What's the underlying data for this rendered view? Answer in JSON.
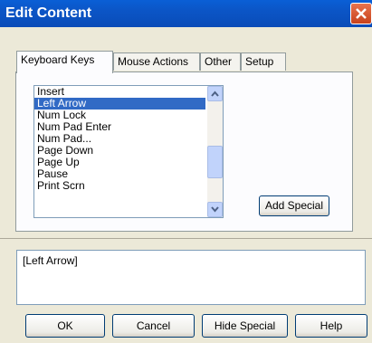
{
  "window": {
    "title": "Edit Content"
  },
  "tabs": [
    {
      "label": "Keyboard Keys",
      "active": true
    },
    {
      "label": "Mouse Actions",
      "active": false
    },
    {
      "label": "Other",
      "active": false
    },
    {
      "label": "Setup",
      "active": false
    }
  ],
  "keys_list": {
    "items": [
      "Insert",
      "Left Arrow",
      "Num Lock",
      "Num Pad Enter",
      "Num Pad...",
      "Page Down",
      "Page Up",
      "Pause",
      "Print Scrn"
    ],
    "selected": "Left Arrow"
  },
  "buttons": {
    "add_special": "Add Special",
    "ok": "OK",
    "cancel": "Cancel",
    "hide_special": "Hide Special",
    "help": "Help"
  },
  "content_field": {
    "value": "[Left Arrow]"
  },
  "icons": {
    "close": "close-icon",
    "scroll_up": "chevron-up-icon",
    "scroll_down": "chevron-down-icon"
  }
}
